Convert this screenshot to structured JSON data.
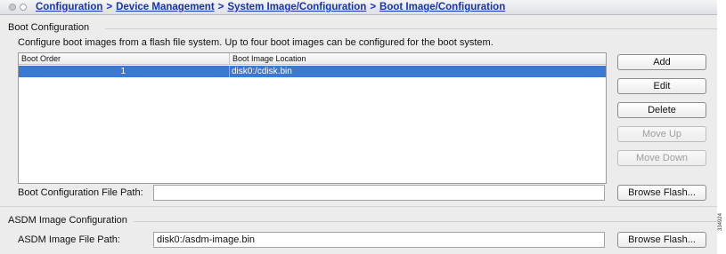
{
  "breadcrumb": {
    "items": [
      "Configuration",
      "Device Management",
      "System Image/Configuration",
      "Boot Image/Configuration"
    ],
    "separator": ">"
  },
  "boot_config": {
    "title": "Boot Configuration",
    "description": "Configure boot images from a flash file system. Up to four boot images can be configured for the boot system.",
    "table": {
      "columns": [
        "Boot Order",
        "Boot Image Location"
      ],
      "rows": [
        {
          "order": "1",
          "location": "disk0:/cdisk.bin",
          "selected": true
        }
      ]
    },
    "buttons": {
      "add": "Add",
      "edit": "Edit",
      "delete": "Delete",
      "move_up": "Move Up",
      "move_down": "Move Down"
    },
    "file_path": {
      "label": "Boot Configuration File Path:",
      "value": "",
      "browse": "Browse Flash..."
    }
  },
  "asdm_config": {
    "title": "ASDM Image Configuration",
    "file_path": {
      "label": "ASDM Image File Path:",
      "value": "disk0:/asdm-image.bin",
      "browse": "Browse Flash..."
    }
  },
  "figure_id": "334924",
  "colors": {
    "link": "#1933b8",
    "selection": "#3b78d4",
    "panel_background": "#ececec"
  }
}
